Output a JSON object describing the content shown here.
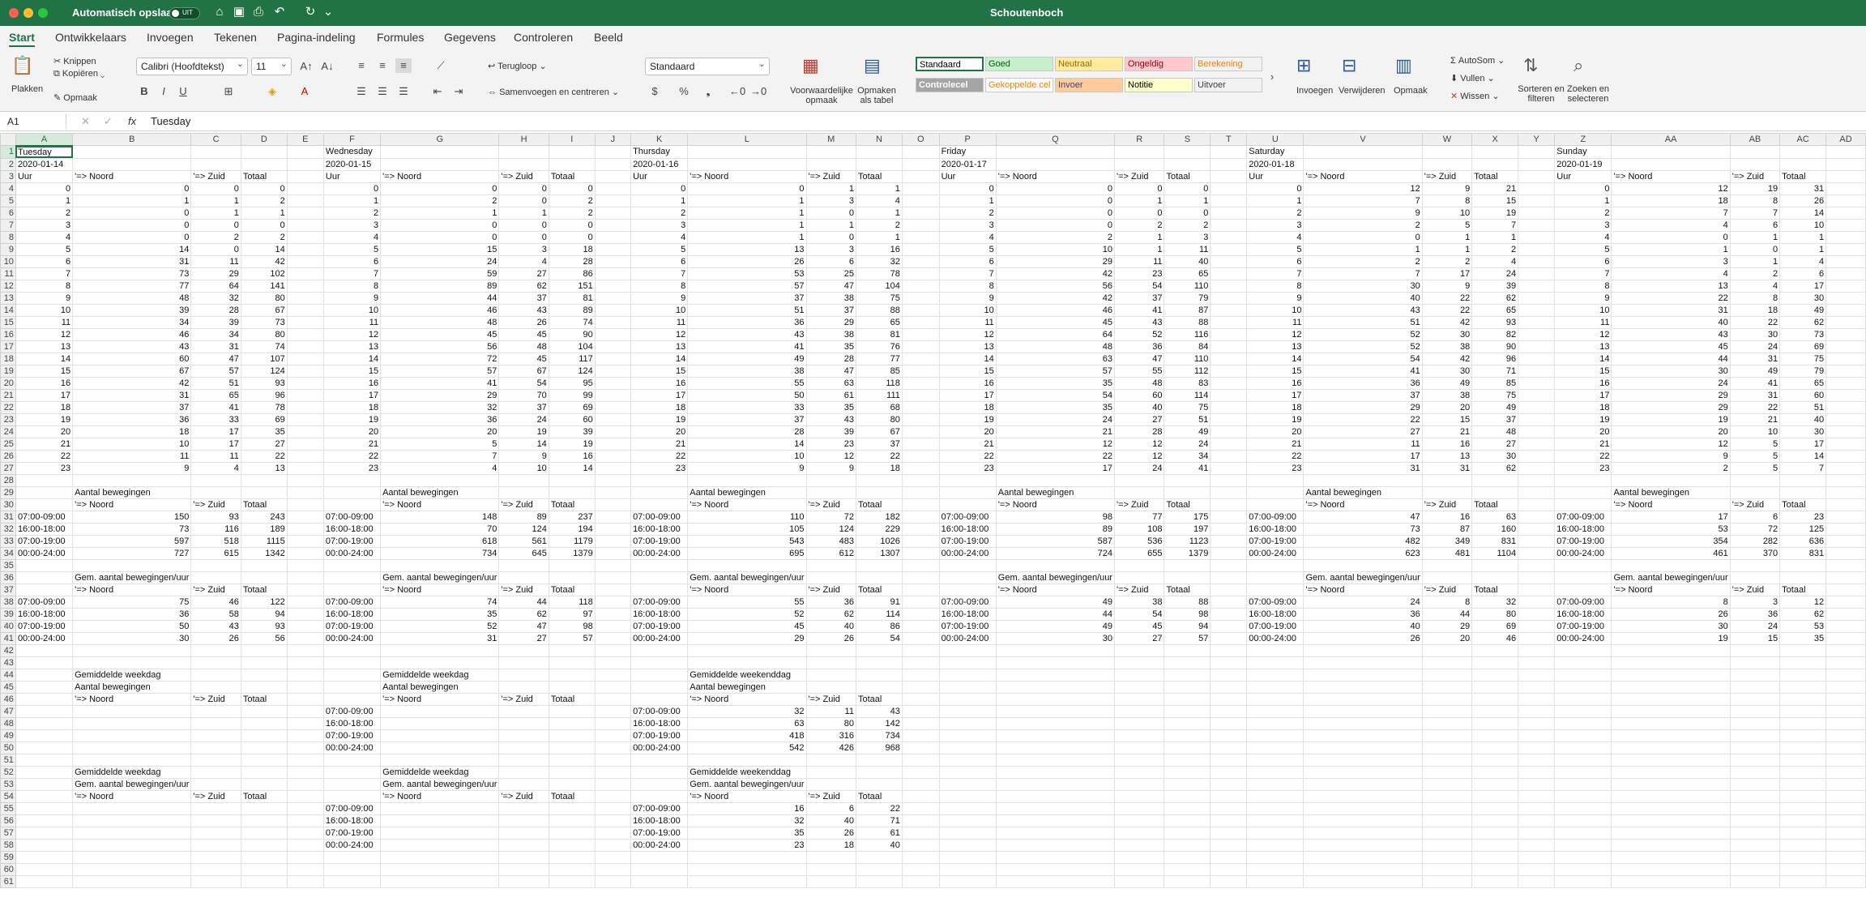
{
  "titlebar": {
    "autosave_label": "Automatisch opslaan",
    "autosave_state": "UIT",
    "doc_title": "Schoutenboch"
  },
  "tabs": [
    "Start",
    "Ontwikkelaars",
    "Invoegen",
    "Tekenen",
    "Pagina-indeling",
    "Formules",
    "Gegevens",
    "Controleren",
    "Beeld"
  ],
  "ribbon": {
    "paste": "Plakken",
    "cut": "Knippen",
    "copy": "Kopiëren",
    "format_painter": "Opmaak",
    "font": "Calibri (Hoofdtekst)",
    "font_size": "11",
    "wrap": "Terugloop",
    "merge": "Samenvoegen en centreren",
    "number_format": "Standaard",
    "cond_format": "Voorwaardelijke opmaak",
    "as_table": "Opmaken als tabel",
    "insert": "Invoegen",
    "delete": "Verwijderen",
    "format": "Opmaak",
    "autosum": "AutoSom",
    "fill": "Vullen",
    "clear": "Wissen",
    "sort": "Sorteren en filteren",
    "find": "Zoeken en selecteren",
    "styles": [
      {
        "label": "Standaard",
        "bg": "#ffffff",
        "fg": "#000000"
      },
      {
        "label": "Goed",
        "bg": "#c6efce",
        "fg": "#006100"
      },
      {
        "label": "Neutraal",
        "bg": "#ffeb9c",
        "fg": "#9c6500"
      },
      {
        "label": "Ongeldig",
        "bg": "#ffc7ce",
        "fg": "#9c0006"
      },
      {
        "label": "Berekening",
        "bg": "#f2f2f2",
        "fg": "#fa7d00"
      },
      {
        "label": "Controlecel",
        "bg": "#a5a5a5",
        "fg": "#ffffff"
      },
      {
        "label": "Gekoppelde cel",
        "bg": "#ffffff",
        "fg": "#fa7d00"
      },
      {
        "label": "Invoer",
        "bg": "#ffcc99",
        "fg": "#3f3f76"
      },
      {
        "label": "Notitie",
        "bg": "#ffffcc",
        "fg": "#000000"
      },
      {
        "label": "Uitvoer",
        "bg": "#f2f2f2",
        "fg": "#3f3f3f"
      }
    ]
  },
  "formula_bar": {
    "name_box": "A1",
    "fx": "fx",
    "content": "Tuesday"
  },
  "sheet": {
    "columns": [
      "A",
      "B",
      "C",
      "D",
      "E",
      "F",
      "G",
      "H",
      "I",
      "J",
      "K",
      "L",
      "M",
      "N",
      "O",
      "P",
      "Q",
      "R",
      "S",
      "T",
      "U",
      "V",
      "W",
      "X",
      "Y",
      "Z",
      "AA",
      "AB",
      "AC",
      "AD"
    ],
    "row_count": 61,
    "days": [
      {
        "day": "Tuesday",
        "date": "2020-01-14",
        "hourly": [
          [
            0,
            0,
            0
          ],
          [
            1,
            1,
            2
          ],
          [
            0,
            1,
            1
          ],
          [
            0,
            0,
            0
          ],
          [
            0,
            2,
            2
          ],
          [
            14,
            0,
            14
          ],
          [
            31,
            11,
            42
          ],
          [
            73,
            29,
            102
          ],
          [
            77,
            64,
            141
          ],
          [
            48,
            32,
            80
          ],
          [
            39,
            28,
            67
          ],
          [
            34,
            39,
            73
          ],
          [
            46,
            34,
            80
          ],
          [
            43,
            31,
            74
          ],
          [
            60,
            47,
            107
          ],
          [
            67,
            57,
            124
          ],
          [
            42,
            51,
            93
          ],
          [
            31,
            65,
            96
          ],
          [
            37,
            41,
            78
          ],
          [
            36,
            33,
            69
          ],
          [
            18,
            17,
            35
          ],
          [
            10,
            17,
            27
          ],
          [
            11,
            11,
            22
          ],
          [
            9,
            4,
            13
          ]
        ],
        "totals": [
          [
            150,
            93,
            243
          ],
          [
            73,
            116,
            189
          ],
          [
            597,
            518,
            1115
          ],
          [
            727,
            615,
            1342
          ]
        ],
        "avgs": [
          [
            75,
            46,
            122
          ],
          [
            36,
            58,
            94
          ],
          [
            50,
            43,
            93
          ],
          [
            30,
            26,
            56
          ]
        ]
      },
      {
        "day": "Wednesday",
        "date": "2020-01-15",
        "hourly": [
          [
            0,
            0,
            0
          ],
          [
            2,
            0,
            2
          ],
          [
            1,
            1,
            2
          ],
          [
            0,
            0,
            0
          ],
          [
            0,
            0,
            0
          ],
          [
            15,
            3,
            18
          ],
          [
            24,
            4,
            28
          ],
          [
            59,
            27,
            86
          ],
          [
            89,
            62,
            151
          ],
          [
            44,
            37,
            81
          ],
          [
            46,
            43,
            89
          ],
          [
            48,
            26,
            74
          ],
          [
            45,
            45,
            90
          ],
          [
            56,
            48,
            104
          ],
          [
            72,
            45,
            117
          ],
          [
            57,
            67,
            124
          ],
          [
            41,
            54,
            95
          ],
          [
            29,
            70,
            99
          ],
          [
            32,
            37,
            69
          ],
          [
            36,
            24,
            60
          ],
          [
            20,
            19,
            39
          ],
          [
            5,
            14,
            19
          ],
          [
            7,
            9,
            16
          ],
          [
            4,
            10,
            14
          ]
        ],
        "totals": [
          [
            148,
            89,
            237
          ],
          [
            70,
            124,
            194
          ],
          [
            618,
            561,
            1179
          ],
          [
            734,
            645,
            1379
          ]
        ],
        "avgs": [
          [
            74,
            44,
            118
          ],
          [
            35,
            62,
            97
          ],
          [
            52,
            47,
            98
          ],
          [
            31,
            27,
            57
          ]
        ]
      },
      {
        "day": "Thursday",
        "date": "2020-01-16",
        "hourly": [
          [
            0,
            1,
            1
          ],
          [
            1,
            3,
            4
          ],
          [
            1,
            0,
            1
          ],
          [
            1,
            1,
            2
          ],
          [
            1,
            0,
            1
          ],
          [
            13,
            3,
            16
          ],
          [
            26,
            6,
            32
          ],
          [
            53,
            25,
            78
          ],
          [
            57,
            47,
            104
          ],
          [
            37,
            38,
            75
          ],
          [
            51,
            37,
            88
          ],
          [
            36,
            29,
            65
          ],
          [
            43,
            38,
            81
          ],
          [
            41,
            35,
            76
          ],
          [
            49,
            28,
            77
          ],
          [
            38,
            47,
            85
          ],
          [
            55,
            63,
            118
          ],
          [
            50,
            61,
            111
          ],
          [
            33,
            35,
            68
          ],
          [
            37,
            43,
            80
          ],
          [
            28,
            39,
            67
          ],
          [
            14,
            23,
            37
          ],
          [
            10,
            12,
            22
          ],
          [
            9,
            9,
            18
          ]
        ],
        "totals": [
          [
            110,
            72,
            182
          ],
          [
            105,
            124,
            229
          ],
          [
            543,
            483,
            1026
          ],
          [
            695,
            612,
            1307
          ]
        ],
        "avgs": [
          [
            55,
            36,
            91
          ],
          [
            52,
            62,
            114
          ],
          [
            45,
            40,
            86
          ],
          [
            29,
            26,
            54
          ]
        ]
      },
      {
        "day": "Friday",
        "date": "2020-01-17",
        "hourly": [
          [
            0,
            0,
            0
          ],
          [
            0,
            1,
            1
          ],
          [
            0,
            0,
            0
          ],
          [
            0,
            2,
            2
          ],
          [
            2,
            1,
            3
          ],
          [
            10,
            1,
            11
          ],
          [
            29,
            11,
            40
          ],
          [
            42,
            23,
            65
          ],
          [
            56,
            54,
            110
          ],
          [
            42,
            37,
            79
          ],
          [
            46,
            41,
            87
          ],
          [
            45,
            43,
            88
          ],
          [
            64,
            52,
            116
          ],
          [
            48,
            36,
            84
          ],
          [
            63,
            47,
            110
          ],
          [
            57,
            55,
            112
          ],
          [
            35,
            48,
            83
          ],
          [
            54,
            60,
            114
          ],
          [
            35,
            40,
            75
          ],
          [
            24,
            27,
            51
          ],
          [
            21,
            28,
            49
          ],
          [
            12,
            12,
            24
          ],
          [
            22,
            12,
            34
          ],
          [
            17,
            24,
            41
          ]
        ],
        "totals": [
          [
            98,
            77,
            175
          ],
          [
            89,
            108,
            197
          ],
          [
            587,
            536,
            1123
          ],
          [
            724,
            655,
            1379
          ]
        ],
        "avgs": [
          [
            49,
            38,
            88
          ],
          [
            44,
            54,
            98
          ],
          [
            49,
            45,
            94
          ],
          [
            30,
            27,
            57
          ]
        ]
      },
      {
        "day": "Saturday",
        "date": "2020-01-18",
        "hourly": [
          [
            12,
            9,
            21
          ],
          [
            7,
            8,
            15
          ],
          [
            9,
            10,
            19
          ],
          [
            2,
            5,
            7
          ],
          [
            0,
            1,
            1
          ],
          [
            1,
            1,
            2
          ],
          [
            2,
            2,
            4
          ],
          [
            7,
            17,
            24
          ],
          [
            30,
            9,
            39
          ],
          [
            40,
            22,
            62
          ],
          [
            43,
            22,
            65
          ],
          [
            51,
            42,
            93
          ],
          [
            52,
            30,
            82
          ],
          [
            52,
            38,
            90
          ],
          [
            54,
            42,
            96
          ],
          [
            41,
            30,
            71
          ],
          [
            36,
            49,
            85
          ],
          [
            37,
            38,
            75
          ],
          [
            29,
            20,
            49
          ],
          [
            22,
            15,
            37
          ],
          [
            27,
            21,
            48
          ],
          [
            11,
            16,
            27
          ],
          [
            17,
            13,
            30
          ],
          [
            31,
            31,
            62
          ]
        ],
        "totals": [
          [
            47,
            16,
            63
          ],
          [
            73,
            87,
            160
          ],
          [
            482,
            349,
            831
          ],
          [
            623,
            481,
            1104
          ]
        ],
        "avgs": [
          [
            24,
            8,
            32
          ],
          [
            36,
            44,
            80
          ],
          [
            40,
            29,
            69
          ],
          [
            26,
            20,
            46
          ]
        ]
      },
      {
        "day": "Sunday",
        "date": "2020-01-19",
        "hourly": [
          [
            12,
            19,
            31
          ],
          [
            18,
            8,
            26
          ],
          [
            7,
            7,
            14
          ],
          [
            4,
            6,
            10
          ],
          [
            0,
            1,
            1
          ],
          [
            1,
            0,
            1
          ],
          [
            3,
            1,
            4
          ],
          [
            4,
            2,
            6
          ],
          [
            13,
            4,
            17
          ],
          [
            22,
            8,
            30
          ],
          [
            31,
            18,
            49
          ],
          [
            40,
            22,
            62
          ],
          [
            43,
            30,
            73
          ],
          [
            45,
            24,
            69
          ],
          [
            44,
            31,
            75
          ],
          [
            30,
            49,
            79
          ],
          [
            24,
            41,
            65
          ],
          [
            29,
            31,
            60
          ],
          [
            29,
            22,
            51
          ],
          [
            19,
            21,
            40
          ],
          [
            20,
            10,
            30
          ],
          [
            12,
            5,
            17
          ],
          [
            9,
            5,
            14
          ],
          [
            2,
            5,
            7
          ]
        ],
        "totals": [
          [
            17,
            6,
            23
          ],
          [
            53,
            72,
            125
          ],
          [
            354,
            282,
            636
          ],
          [
            461,
            370,
            831
          ]
        ],
        "avgs": [
          [
            8,
            3,
            12
          ],
          [
            26,
            36,
            62
          ],
          [
            30,
            24,
            53
          ],
          [
            19,
            15,
            35
          ]
        ]
      }
    ],
    "labels": {
      "uur": "Uur",
      "noord": "'=> Noord",
      "zuid": "'=> Zuid",
      "totaal": "Totaal",
      "aantal": "Aantal bewegingen",
      "gem": "Gem. aantal bewegingen/uur",
      "weekdag": "Gemiddelde weekdag",
      "weekenddag": "Gemiddelde weekenddag"
    },
    "periods": [
      "07:00-09:00",
      "16:00-18:00",
      "07:00-19:00",
      "00:00-24:00"
    ],
    "weekend_avg_counts": [
      [
        32,
        11,
        43
      ],
      [
        63,
        80,
        142
      ],
      [
        418,
        316,
        734
      ],
      [
        542,
        426,
        968
      ]
    ],
    "weekend_avg_rates": [
      [
        16,
        6,
        22
      ],
      [
        32,
        40,
        71
      ],
      [
        35,
        26,
        61
      ],
      [
        23,
        18,
        40
      ]
    ]
  }
}
